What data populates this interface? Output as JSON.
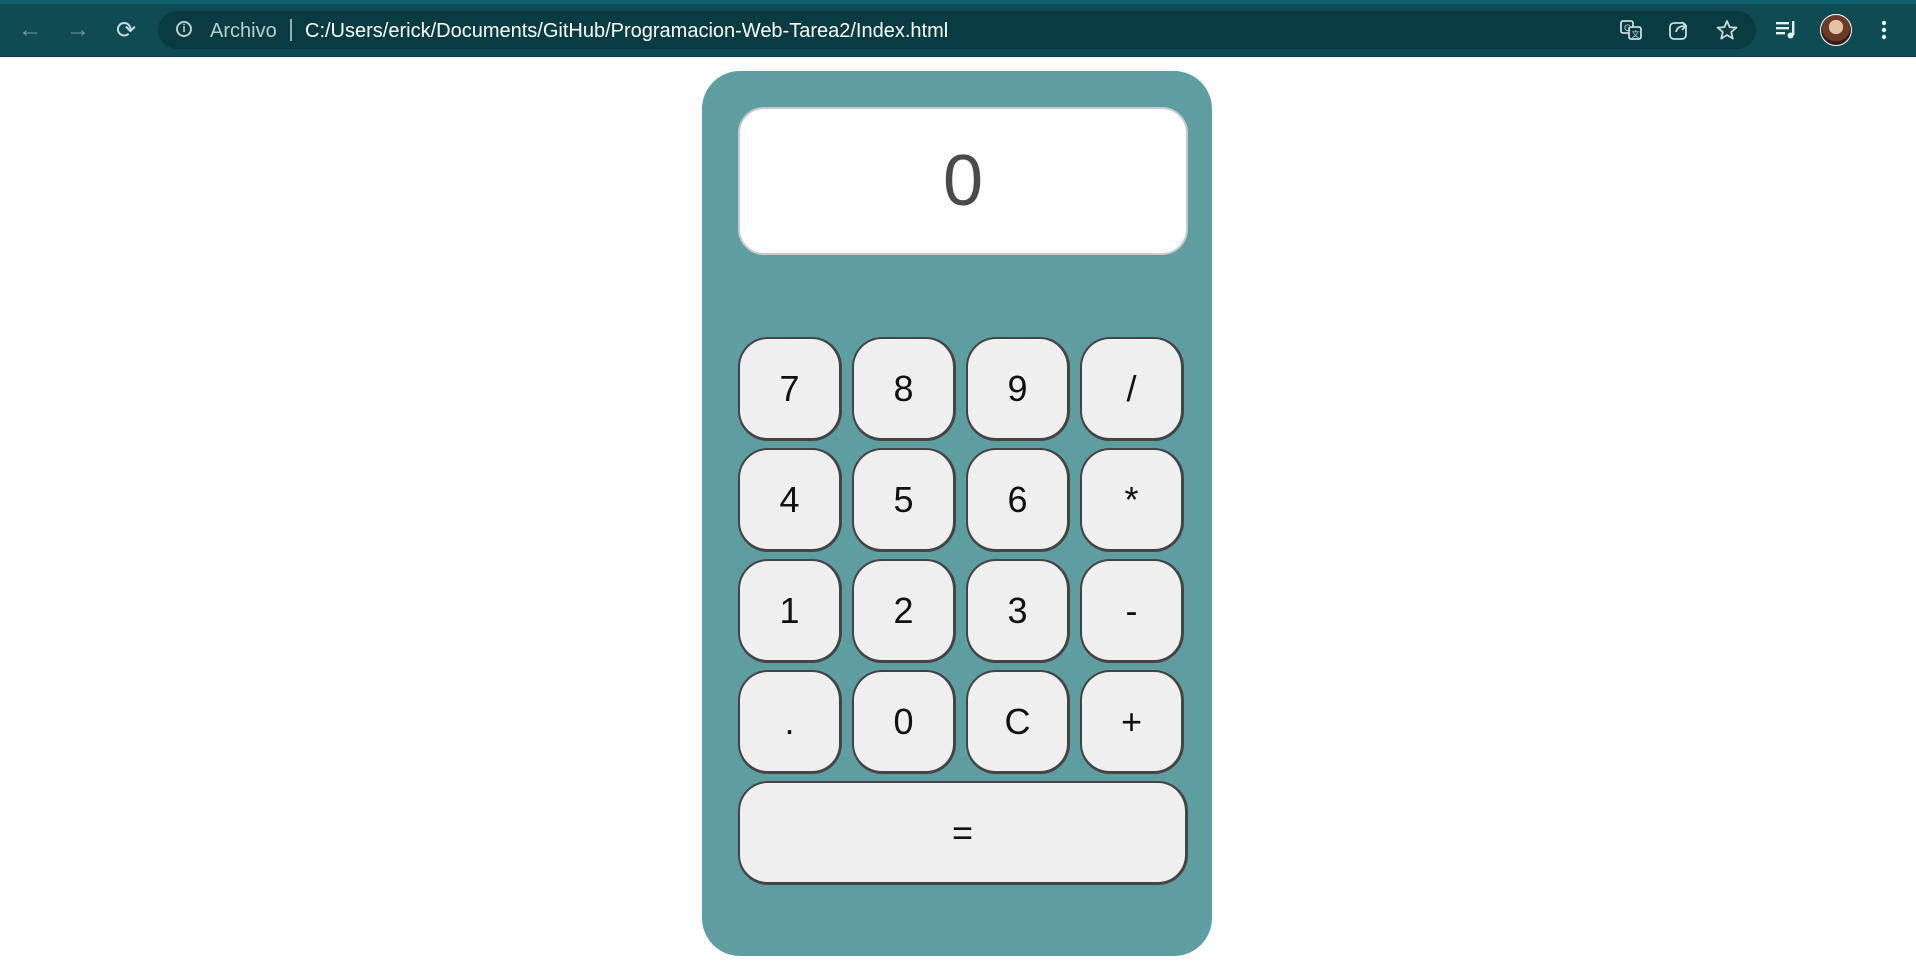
{
  "browser": {
    "origin_label": "Archivo",
    "url": "C:/Users/erick/Documents/GitHub/Programacion-Web-Tarea2/Index.html",
    "back_icon": "←",
    "forward_icon": "→",
    "reload_icon": "⟳",
    "theme_color": "#0e4b52"
  },
  "calculator": {
    "display_value": "0",
    "body_color": "#5f9ea0",
    "rows": [
      [
        "7",
        "8",
        "9",
        "/"
      ],
      [
        "4",
        "5",
        "6",
        "*"
      ],
      [
        "1",
        "2",
        "3",
        "-"
      ],
      [
        ".",
        "0",
        "C",
        "+"
      ]
    ],
    "equals_label": "="
  }
}
